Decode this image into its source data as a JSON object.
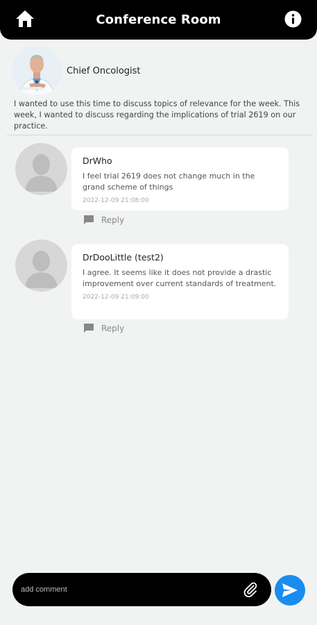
{
  "header": {
    "title": "Conference Room",
    "home_icon": "home-icon",
    "info_icon": "info-icon"
  },
  "post": {
    "author": "Chief Oncologist",
    "body": "I wanted to use this time to discuss topics of relevance for the week. This week, I wanted to discuss regarding the implications of trial 2619 on our practice."
  },
  "comments": [
    {
      "name": "DrWho",
      "text": "I feel trial 2619 does not change much in the grand scheme of things",
      "time": "2022-12-09 21:08:00",
      "reply_label": "Reply"
    },
    {
      "name": "DrDooLittle (test2)",
      "text": "I agree. It seems like it does not provide a drastic improvement over current standards of treatment.",
      "time": "2022-12-09 21:09:00",
      "reply_label": "Reply"
    }
  ],
  "composer": {
    "placeholder": "add comment",
    "value": ""
  },
  "colors": {
    "header_bg": "#000000",
    "page_bg": "#f1f3f3",
    "send_button": "#1a8cf0"
  }
}
